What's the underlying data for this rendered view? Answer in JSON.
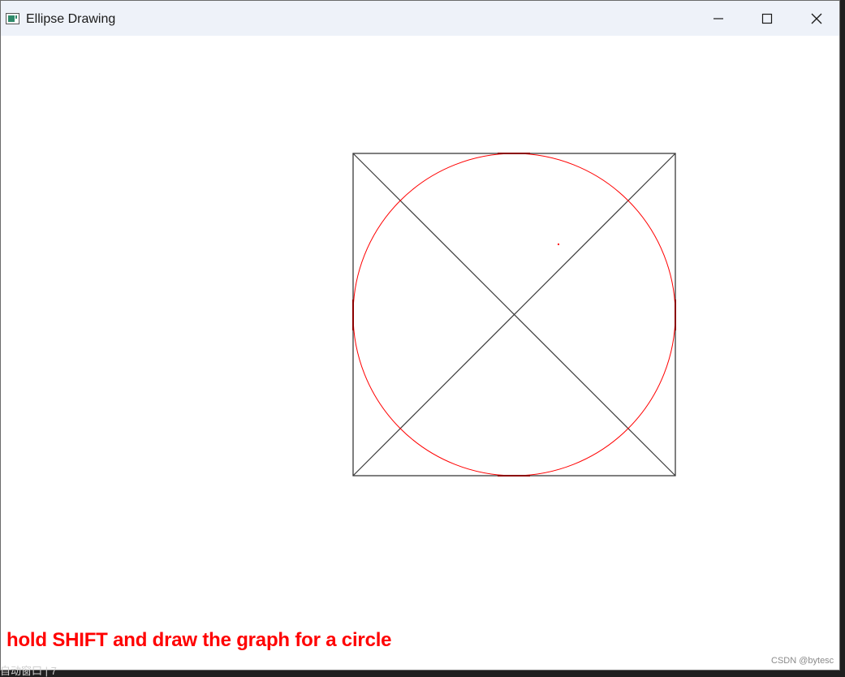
{
  "window": {
    "title": "Ellipse Drawing",
    "icon": "app-window-icon"
  },
  "caption_buttons": {
    "minimize_icon": "minimize-icon",
    "maximize_icon": "maximize-icon",
    "close_icon": "close-icon"
  },
  "canvas": {
    "hint_text": "hold SHIFT and draw the graph for a circle",
    "hint_color": "#ff0000",
    "rectangle_color": "#3a3a3a",
    "ellipse_color": "#ff0000"
  },
  "watermark": "CSDN @bytesc",
  "background_text": "自动窗口 | 7"
}
